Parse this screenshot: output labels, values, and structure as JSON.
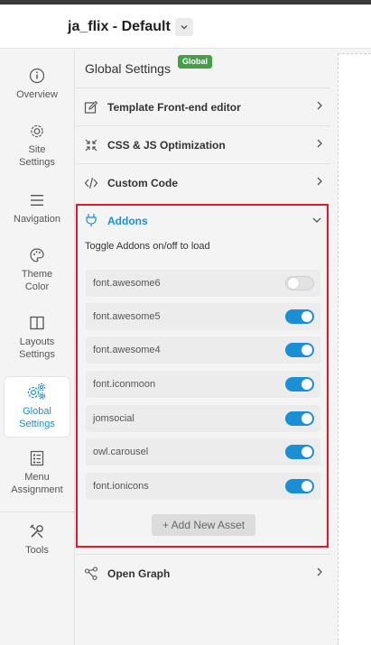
{
  "header": {
    "title": "ja_flix - Default"
  },
  "sidebar": {
    "items": [
      {
        "label": "Overview",
        "icon": "info-icon"
      },
      {
        "label": "Site Settings",
        "icon": "gear-icon"
      },
      {
        "label": "Navigation",
        "icon": "hamburger-icon"
      },
      {
        "label": "Theme Color",
        "icon": "palette-icon"
      },
      {
        "label": "Layouts Settings",
        "icon": "layout-icon"
      },
      {
        "label": "Global Settings",
        "icon": "gears-icon"
      },
      {
        "label": "Menu Assignment",
        "icon": "checklist-icon"
      },
      {
        "label": "Tools",
        "icon": "tools-icon"
      }
    ],
    "active_index": 5
  },
  "panel": {
    "title": "Global Settings",
    "badge": "Global",
    "rows": [
      {
        "label": "Template Front-end editor",
        "icon": "edit-icon"
      },
      {
        "label": "CSS & JS Optimization",
        "icon": "compress-icon"
      },
      {
        "label": "Custom Code",
        "icon": "code-icon"
      }
    ],
    "addons": {
      "title": "Addons",
      "description": "Toggle Addons on/off to load",
      "items": [
        {
          "name": "font.awesome6",
          "enabled": false
        },
        {
          "name": "font.awesome5",
          "enabled": true
        },
        {
          "name": "font.awesome4",
          "enabled": true
        },
        {
          "name": "font.iconmoon",
          "enabled": true
        },
        {
          "name": "jomsocial",
          "enabled": true
        },
        {
          "name": "owl.carousel",
          "enabled": true
        },
        {
          "name": "font.ionicons",
          "enabled": true
        }
      ],
      "add_button": "+ Add New Asset"
    },
    "open_graph": {
      "label": "Open Graph",
      "icon": "share-icon"
    }
  },
  "colors": {
    "accent": "#1a8fd6",
    "highlight": "#e0192b",
    "badge": "#43a047"
  }
}
